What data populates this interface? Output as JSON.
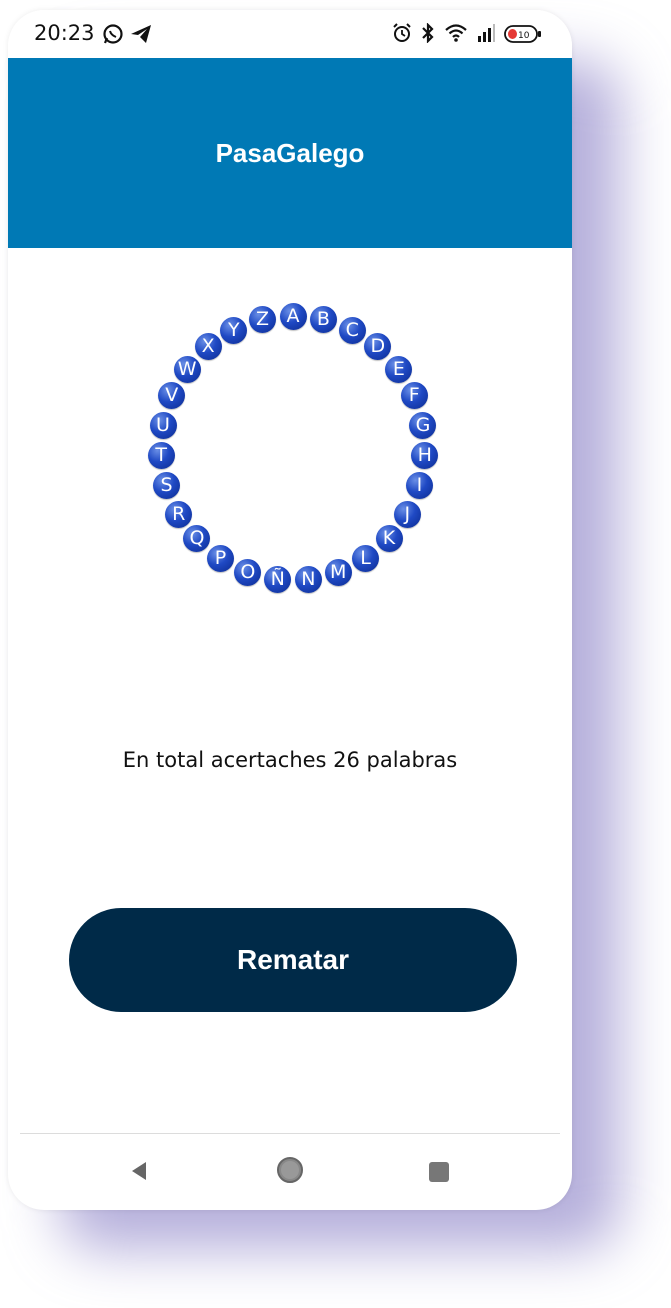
{
  "status_bar": {
    "time": "20:23",
    "left_icons": [
      "whatsapp-icon",
      "telegram-icon"
    ],
    "right_icons": [
      "alarm-icon",
      "bluetooth-icon",
      "wifi-icon",
      "signal-icon",
      "battery-icon"
    ]
  },
  "header": {
    "title": "PasaGalego"
  },
  "rosco": {
    "letters": [
      "A",
      "B",
      "C",
      "D",
      "E",
      "F",
      "G",
      "H",
      "I",
      "J",
      "K",
      "L",
      "M",
      "N",
      "Ñ",
      "O",
      "P",
      "Q",
      "R",
      "S",
      "T",
      "U",
      "V",
      "W",
      "X",
      "Y",
      "Z"
    ],
    "color": "#1f49c4"
  },
  "result": {
    "text": "En total acertaches 26 palabras"
  },
  "actions": {
    "rematar_label": "Rematar"
  },
  "nav_bar": {
    "icons": [
      "back-icon",
      "home-icon",
      "recents-icon"
    ]
  },
  "colors": {
    "header": "#0079b5",
    "button": "#002a48"
  }
}
